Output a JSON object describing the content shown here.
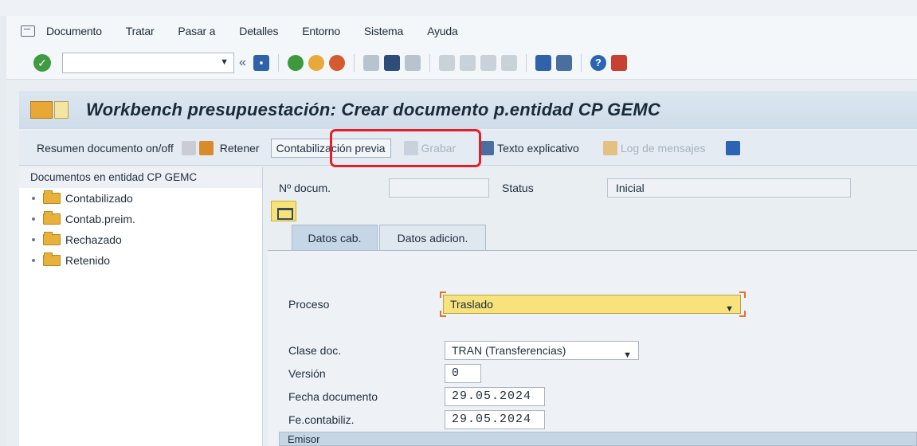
{
  "menu": {
    "items": [
      "Documento",
      "Tratar",
      "Pasar a",
      "Detalles",
      "Entorno",
      "Sistema",
      "Ayuda"
    ]
  },
  "toolbar": {
    "command_value": "",
    "icons": [
      "enter-icon",
      "save-icon",
      "back-icon",
      "exit-icon",
      "cancel-icon",
      "print-icon",
      "find-icon",
      "find-next-icon",
      "first-page-icon",
      "prev-page-icon",
      "next-page-icon",
      "last-page-icon",
      "new-session-icon",
      "shortcut-icon",
      "help-icon",
      "layout-icon"
    ]
  },
  "title": {
    "text": "Workbench presupuestación: Crear documento p.entidad CP GEMC"
  },
  "app_toolbar": {
    "resumen": "Resumen documento on/off",
    "retener": "Retener",
    "contab_previa": "Contabilización previa",
    "grabar": "Grabar",
    "texto_explicativo": "Texto explicativo",
    "log_mensajes": "Log de mensajes"
  },
  "tree": {
    "header": "Documentos en entidad CP GEMC",
    "items": [
      "Contabilizado",
      "Contab.preim.",
      "Rechazado",
      "Retenido"
    ]
  },
  "header_fields": {
    "num_label": "Nº docum.",
    "num_value": "",
    "status_label": "Status",
    "status_value": "Inicial"
  },
  "tabs": [
    "Datos cab.",
    "Datos adicion."
  ],
  "form": {
    "proceso_label": "Proceso",
    "proceso_value": "Traslado",
    "clase_label": "Clase doc.",
    "clase_value": "TRAN (Transferencias)",
    "version_label": "Versión",
    "version_value": "0",
    "fecha_doc_label": "Fecha documento",
    "fecha_doc_value": "29.05.2024",
    "fe_contab_label": "Fe.contabiliz.",
    "fe_contab_value": "29.05.2024",
    "emisor_label": "Emisor"
  },
  "colors": {
    "highlight_border": "#e3202a",
    "required_field": "#f8e27c",
    "title_bg": "#d5e1ec"
  }
}
